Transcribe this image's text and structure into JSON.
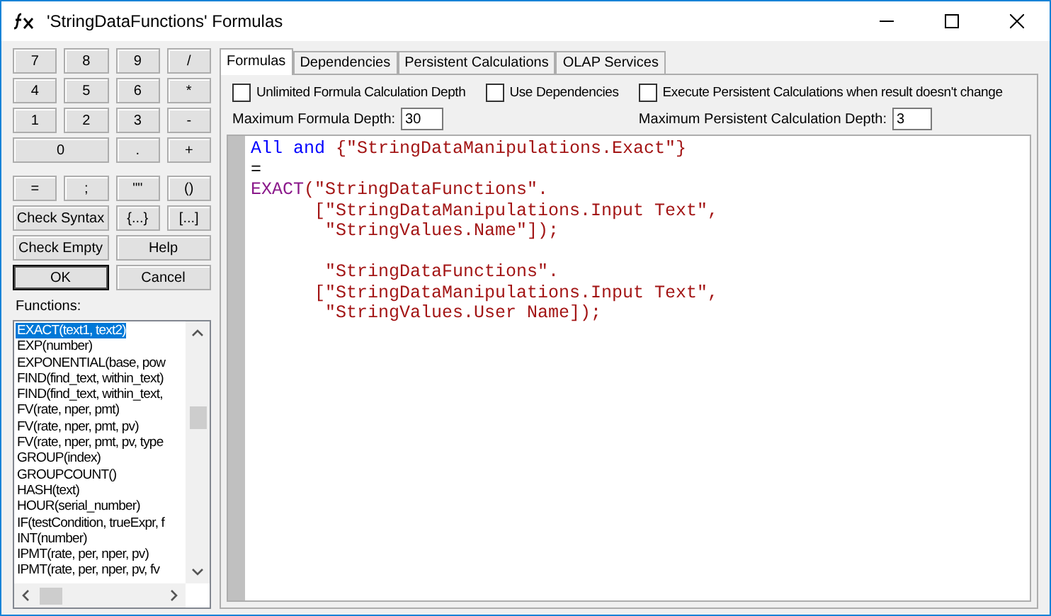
{
  "window": {
    "title": "'StringDataFunctions' Formulas"
  },
  "keypad": [
    [
      {
        "label": "7",
        "default": false
      },
      {
        "label": "8",
        "default": false
      },
      {
        "label": "9",
        "default": false
      },
      {
        "label": "/",
        "default": false
      }
    ],
    [
      {
        "label": "4",
        "default": false
      },
      {
        "label": "5",
        "default": false
      },
      {
        "label": "6",
        "default": false
      },
      {
        "label": "*",
        "default": false
      }
    ],
    [
      {
        "label": "1",
        "default": false
      },
      {
        "label": "2",
        "default": false
      },
      {
        "label": "3",
        "default": false
      },
      {
        "label": "-",
        "default": false
      }
    ],
    [
      {
        "label": "0",
        "default": false
      },
      {
        "label": ".",
        "default": false
      },
      {
        "label": "+",
        "default": false
      }
    ]
  ],
  "operators": [
    [
      {
        "label": "=",
        "default": false
      },
      {
        "label": ";",
        "default": false
      },
      {
        "label": "\"\"",
        "default": false
      },
      {
        "label": "()",
        "default": false
      }
    ],
    [
      {
        "label": "Check Syntax",
        "default": false
      },
      {
        "label": "{...}",
        "default": false
      },
      {
        "label": "[...]",
        "default": false
      }
    ],
    [
      {
        "label": "Check Empty",
        "default": false
      },
      {
        "label": "Help",
        "default": false
      }
    ],
    [
      {
        "label": "OK",
        "default": true
      },
      {
        "label": "Cancel",
        "default": false
      }
    ]
  ],
  "functions": {
    "label": "Functions:",
    "items": [
      {
        "text": "EXACT(text1, text2)",
        "selected": true
      },
      {
        "text": "EXP(number)",
        "selected": false
      },
      {
        "text": "EXPONENTIAL(base, pow",
        "selected": false
      },
      {
        "text": "FIND(find_text, within_text)",
        "selected": false
      },
      {
        "text": "FIND(find_text, within_text,",
        "selected": false
      },
      {
        "text": "FV(rate, nper, pmt)",
        "selected": false
      },
      {
        "text": "FV(rate, nper, pmt, pv)",
        "selected": false
      },
      {
        "text": "FV(rate, nper, pmt, pv, type",
        "selected": false
      },
      {
        "text": "GROUP(index)",
        "selected": false
      },
      {
        "text": "GROUPCOUNT()",
        "selected": false
      },
      {
        "text": "HASH(text)",
        "selected": false
      },
      {
        "text": "HOUR(serial_number)",
        "selected": false
      },
      {
        "text": "IF(testCondition, trueExpr, f",
        "selected": false
      },
      {
        "text": "INT(number)",
        "selected": false
      },
      {
        "text": "IPMT(rate, per, nper, pv)",
        "selected": false
      },
      {
        "text": "IPMT(rate, per, nper, pv, fv",
        "selected": false
      }
    ]
  },
  "tabs": [
    {
      "label": "Formulas",
      "selected": true
    },
    {
      "label": "Dependencies",
      "selected": false
    },
    {
      "label": "Persistent Calculations",
      "selected": false
    },
    {
      "label": "OLAP Services",
      "selected": false
    }
  ],
  "options": [
    {
      "label": "Unlimited Formula Calculation Depth",
      "checked": false
    },
    {
      "label": "Use Dependencies",
      "checked": false
    },
    {
      "label": "Execute Persistent Calculations when result doesn't change",
      "checked": false
    }
  ],
  "depth_fields": [
    {
      "label": "Maximum Formula Depth:",
      "value": "30"
    },
    {
      "label": "Maximum Persistent Calculation Depth:",
      "value": "3"
    }
  ],
  "editor": {
    "lines": [
      {
        "tokens": [
          {
            "kind": "keyword",
            "text": "All and "
          },
          {
            "kind": "string",
            "text": "{\"StringDataManipulations.Exact\"}"
          }
        ]
      },
      {
        "tokens": [
          {
            "kind": "plain",
            "text": "="
          }
        ]
      },
      {
        "tokens": [
          {
            "kind": "function",
            "text": "EXACT"
          },
          {
            "kind": "string",
            "text": "(\"StringDataFunctions\"."
          }
        ]
      },
      {
        "tokens": [
          {
            "kind": "string",
            "text": "      [\"StringDataManipulations.Input Text\","
          }
        ]
      },
      {
        "tokens": [
          {
            "kind": "string",
            "text": "       \"StringValues.Name\"]);"
          }
        ]
      },
      {
        "blank_before": true,
        "tokens": [
          {
            "kind": "string",
            "text": "       \"StringDataFunctions\"."
          }
        ]
      },
      {
        "tokens": [
          {
            "kind": "string",
            "text": "      [\"StringDataManipulations.Input Text\","
          }
        ]
      },
      {
        "tokens": [
          {
            "kind": "string",
            "text": "       \"StringValues.User Name]);"
          }
        ]
      }
    ]
  }
}
